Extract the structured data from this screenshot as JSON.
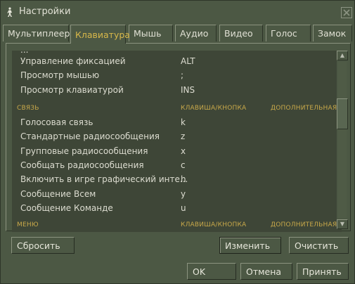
{
  "window": {
    "title": "Настройки",
    "colors": {
      "background": "#4c5844",
      "list_background": "#3e4637",
      "accent": "#d8b84a",
      "text": "#dcdcd0"
    }
  },
  "tabs": [
    {
      "label": "Мультиплеер",
      "active": false
    },
    {
      "label": "Клавиатура",
      "active": true
    },
    {
      "label": "Мышь",
      "active": false
    },
    {
      "label": "Аудио",
      "active": false
    },
    {
      "label": "Видео",
      "active": false
    },
    {
      "label": "Голос",
      "active": false
    },
    {
      "label": "Замок",
      "active": false
    }
  ],
  "list": {
    "partial_top_label": "...",
    "rows_top": [
      {
        "action": "Управление фиксацией",
        "key": "ALT"
      },
      {
        "action": "Просмотр мышью",
        "key": ";"
      },
      {
        "action": "Просмотр клавиатурой",
        "key": "INS"
      }
    ],
    "section_voice": {
      "name": "СВЯЗЬ",
      "col_key": "КЛАВИША/КНОПКА",
      "col_alt": "ДОПОЛНИТЕЛЬНАЯ"
    },
    "rows_voice": [
      {
        "action": "Голосовая связь",
        "key": "k"
      },
      {
        "action": "Стандартные радиосообщения",
        "key": "z"
      },
      {
        "action": "Групповые радиосообщения",
        "key": "x"
      },
      {
        "action": "Сообщать радиосообщения",
        "key": "c"
      },
      {
        "action": "Включить в игре графический инте...",
        "key": "h"
      },
      {
        "action": "Сообщение Всем",
        "key": "y"
      },
      {
        "action": "Сообщение Команде",
        "key": "u"
      }
    ],
    "section_menu": {
      "name": "МЕНЮ",
      "col_key": "КЛАВИША/КНОПКА",
      "col_alt": "ДОПОЛНИТЕЛЬНАЯ"
    }
  },
  "buttons": {
    "reset": "Сбросить",
    "change": "Изменить",
    "clear": "Очистить",
    "ok": "OK",
    "cancel": "Отмена",
    "apply": "Принять"
  },
  "icons": {
    "title": "player-figure-icon",
    "close": "close-icon",
    "scroll_up": "triangle-up-icon",
    "scroll_down": "triangle-down-icon"
  }
}
